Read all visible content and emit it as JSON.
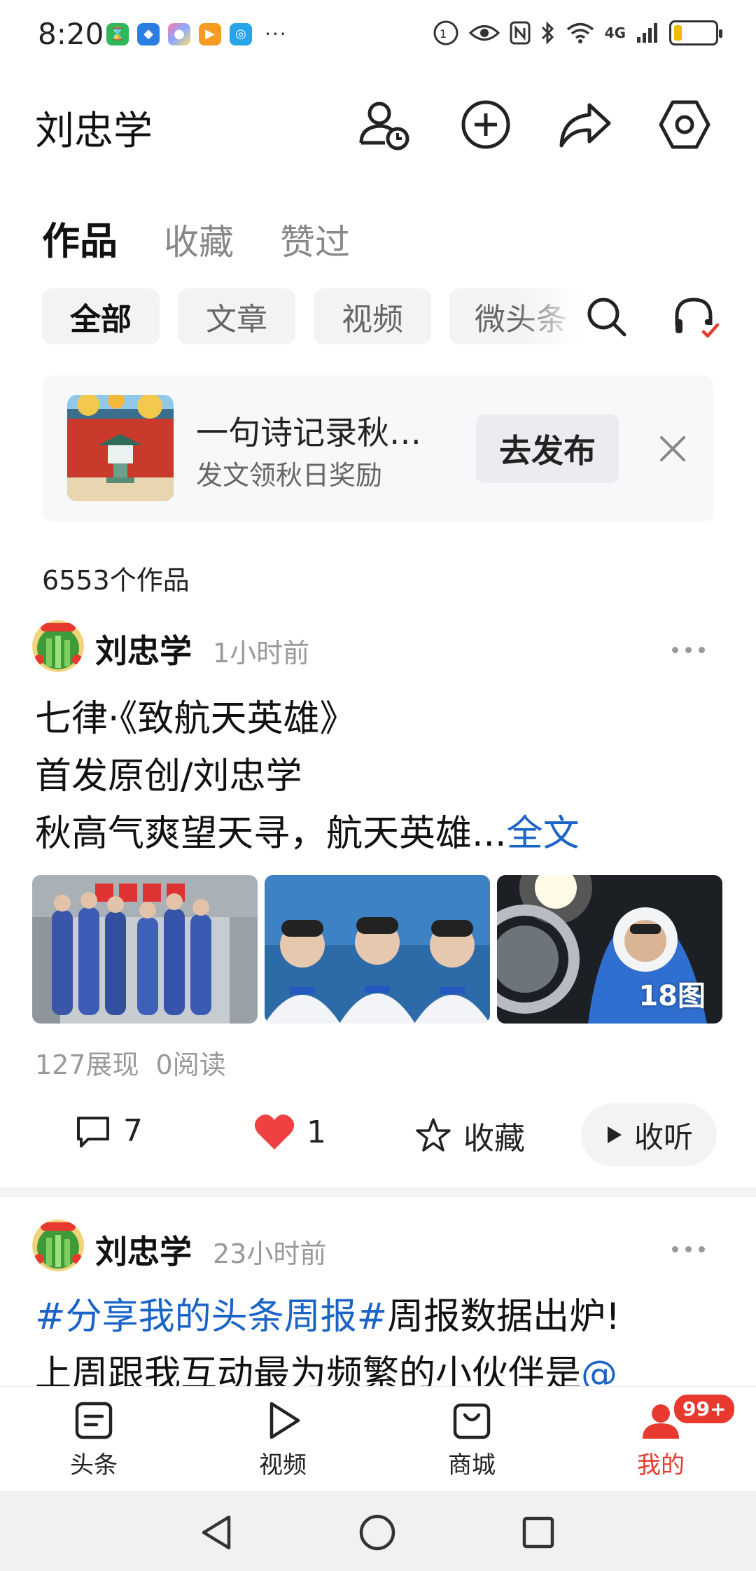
{
  "status_bar": {
    "time": "8:20",
    "more": "···",
    "network": "4G",
    "battery_level": 0.2
  },
  "header": {
    "user_name": "刘忠学"
  },
  "tabs": [
    {
      "label": "作品",
      "active": true
    },
    {
      "label": "收藏",
      "active": false
    },
    {
      "label": "赞过",
      "active": false
    }
  ],
  "filters": [
    {
      "label": "全部",
      "active": true
    },
    {
      "label": "文章",
      "active": false
    },
    {
      "label": "视频",
      "active": false
    },
    {
      "label": "微头条",
      "active": false
    }
  ],
  "promo": {
    "title": "一句诗记录秋…",
    "subtitle": "发文领秋日奖励",
    "button": "去发布"
  },
  "works_count": "6553个作品",
  "posts": [
    {
      "author": "刘忠学",
      "time": "1小时前",
      "lines": [
        "七律·《致航天英雄》",
        "首发原创/刘忠学",
        "秋高气爽望天寻，航天英雄..."
      ],
      "more_link": "全文",
      "image_badge": "18图",
      "stats": {
        "views": "127展现",
        "reads": "0阅读"
      },
      "actions": {
        "comments": "7",
        "likes": "1",
        "favorite": "收藏",
        "listen": "收听"
      }
    },
    {
      "author": "刘忠学",
      "time": "23小时前",
      "hashtag": "#分享我的头条周报#",
      "line1_rest": "周报数据出炉!",
      "line2": "上周跟我互动最为频繁的小伙伴是",
      "line2_link": "@"
    }
  ],
  "bottom_nav": [
    {
      "label": "头条",
      "icon": "news-icon",
      "active": false
    },
    {
      "label": "视频",
      "icon": "play-icon",
      "active": false
    },
    {
      "label": "商城",
      "icon": "shop-icon",
      "active": false
    },
    {
      "label": "我的",
      "icon": "profile-icon",
      "active": true,
      "badge": "99+"
    }
  ],
  "colors": {
    "accent_red": "#e8392e",
    "link_blue": "#1a64c8"
  }
}
